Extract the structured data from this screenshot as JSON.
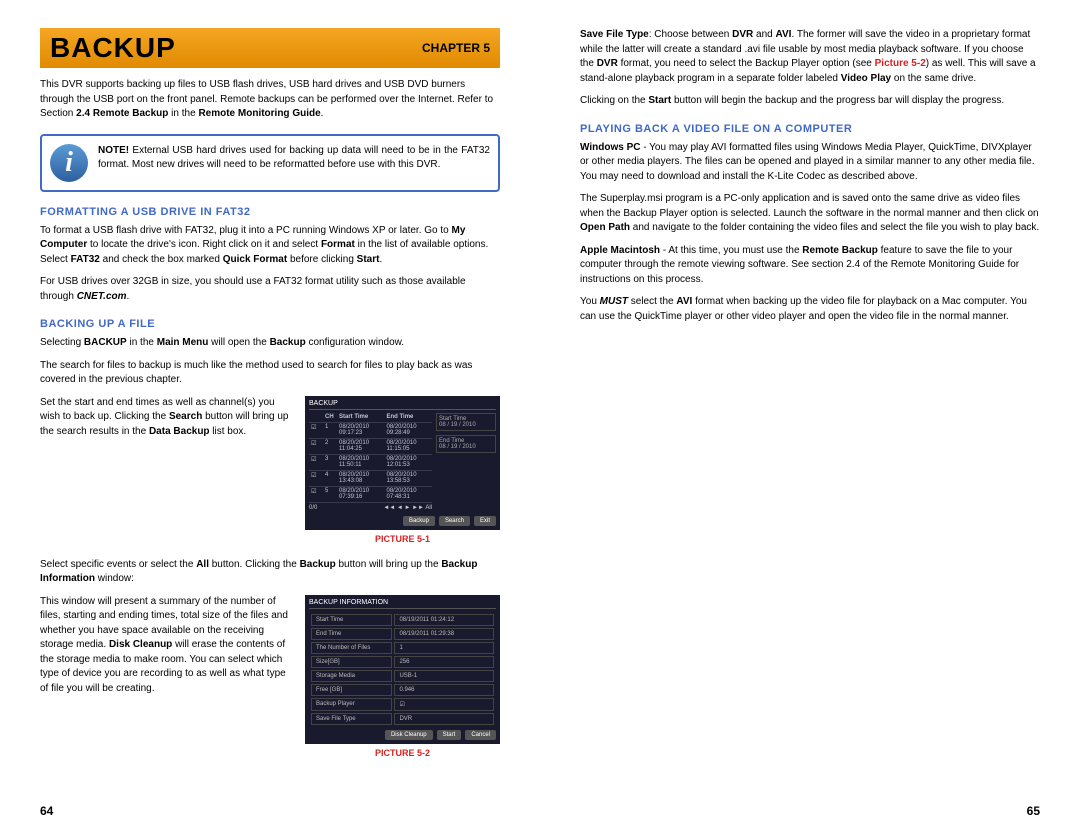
{
  "banner": {
    "title": "BACKUP",
    "chapter": "CHAPTER 5"
  },
  "left": {
    "intro": "This DVR supports backing up files to USB flash drives, USB hard drives and USB DVD burners through the USB port on the front panel. Remote backups can be performed over the Internet. Refer to Section ",
    "intro_b1": "2.4 Remote Backup",
    "intro_mid": " in the ",
    "intro_b2": "Remote Monitoring Guide",
    "intro_end": ".",
    "note_label": "NOTE!",
    "note": " External USB hard drives used for backing up data will need to be in the FAT32 format. Most new drives will need to be reformatted before use with this DVR.",
    "h1": "FORMATTING A USB DRIVE IN FAT32",
    "fmt1": "To format a USB flash drive with FAT32, plug it into a PC running Windows XP or later. Go to ",
    "fmt_b1": "My Computer",
    "fmt2": " to locate the drive's icon. Right click on it and select ",
    "fmt_b2": "Format",
    "fmt3": " in the list of available options. Select ",
    "fmt_b3": "FAT32",
    "fmt4": " and check the box marked ",
    "fmt_b4": "Quick Format",
    "fmt5": " before clicking ",
    "fmt_b5": "Start",
    "fmt6": ".",
    "fmt7": "For USB drives over 32GB in size, you should use a FAT32 format utility such as those available through ",
    "fmt_b6": "CNET.com",
    "fmt8": ".",
    "h2": "BACKING UP A FILE",
    "bk1": "Selecting ",
    "bk_b1": "BACKUP",
    "bk2": " in the ",
    "bk_b2": "Main Menu",
    "bk3": " will open the ",
    "bk_b3": "Backup",
    "bk4": " configuration window.",
    "bk5": "The search for files to backup is much like the method used to search for files to play back as was covered in the previous chapter.",
    "bk6a": "Set the start and end times as well as channel(s) you wish to back up. Clicking the ",
    "bk6b": "Search",
    "bk6c": " button will bring up the search results in the ",
    "bk6d": "Data Backup",
    "bk6e": " list box.",
    "cap1": "PICTURE 5-1",
    "bk7a": "Select specific events or select the ",
    "bk7b": "All",
    "bk7c": " button. Clicking the ",
    "bk7d": "Backup",
    "bk7e": " button will bring up the ",
    "bk7f": "Backup Information",
    "bk7g": " window:",
    "bk8a": "This window will present a summary of the number of files, starting and ending times, total size of the files and whether you have space available on the receiving storage media. ",
    "bk8b": "Disk Cleanup",
    "bk8c": " will erase the contents of the storage media to make room. You can select which type of device you are recording to as well as what type of file you will be creating.",
    "cap2": "PICTURE 5-2",
    "pnum": "64",
    "fig1": {
      "title": "BACKUP",
      "hdrs": [
        "CH",
        "Start Time",
        "End Time"
      ],
      "side_label": "Start Time",
      "side_date": "08 / 19 / 2010",
      "side_end": "End Time",
      "rows": [
        [
          "1",
          "08/20/2010 09:17:23",
          "08/20/2010 09:28:49"
        ],
        [
          "2",
          "08/20/2010 11:04:25",
          "08/20/2010 11:15:05"
        ],
        [
          "3",
          "08/20/2010 11:50:11",
          "08/20/2010 12:01:53"
        ],
        [
          "4",
          "08/20/2010 13:43:08",
          "08/20/2010 13:58:53"
        ],
        [
          "5",
          "08/20/2010 07:39:16",
          "08/20/2010 07:48:31"
        ]
      ],
      "btns": [
        "Backup",
        "Search",
        "Exit"
      ]
    },
    "fig2": {
      "title": "BACKUP INFORMATION",
      "rows": [
        [
          "Start Time",
          "08/19/2011 01:24:12"
        ],
        [
          "End Time",
          "08/19/2011 01:29:38"
        ],
        [
          "The Number of Files",
          "1"
        ],
        [
          "Size[GB]",
          "256"
        ],
        [
          "Storage Media",
          "USB-1"
        ],
        [
          "Free [GB]",
          "0.946"
        ],
        [
          "Backup Player",
          "☑"
        ],
        [
          "Save File Type",
          "DVR"
        ]
      ],
      "btns": [
        "Disk Cleanup",
        "Start",
        "Cancel"
      ]
    }
  },
  "right": {
    "p1a": "Save File Type",
    "p1b": ": Choose between ",
    "p1c": "DVR",
    "p1d": " and ",
    "p1e": "AVI",
    "p1f": ". The former will save the video in a proprietary format while the latter will create a standard .avi file usable by most media playback software. If you choose the ",
    "p1g": "DVR",
    "p1h": " format, you need to select the Backup Player option (see ",
    "p1i": "Picture 5-2",
    "p1j": ") as well. This will save a stand-alone playback program in a separate folder labeled ",
    "p1k": "Video Play",
    "p1l": " on the same drive.",
    "p2a": "Clicking on the ",
    "p2b": "Start",
    "p2c": " button will begin the backup and the progress bar will display the progress.",
    "h1": "PLAYING BACK A VIDEO FILE ON A COMPUTER",
    "p3a": "Windows PC",
    "p3b": " - You may play AVI formatted files using Windows Media Player, QuickTime, DIVXplayer or other media players. The files can be opened and played in a similar manner to any other media file. You may need to download and install the K-Lite Codec as described above.",
    "p4a": "The Superplay.msi program is a PC-only application and is saved onto the same drive as video files when the Backup Player option is selected. Launch the software in the normal manner and then click on ",
    "p4b": "Open Path",
    "p4c": " and navigate to the folder containing the video files and select the file you wish to play back.",
    "p5a": "Apple Macintosh",
    "p5b": " - At this time, you must use the ",
    "p5c": "Remote Backup",
    "p5d": " feature to save the file to your computer through the remote viewing software. See section 2.4 of the Remote Monitoring Guide for instructions on this process.",
    "p6a": "You ",
    "p6b": "MUST",
    "p6c": " select the ",
    "p6d": "AVI",
    "p6e": " format when backing up the video file for playback on a Mac computer. You can use the QuickTime player or other video player and open the video file in the normal manner.",
    "pnum": "65"
  }
}
